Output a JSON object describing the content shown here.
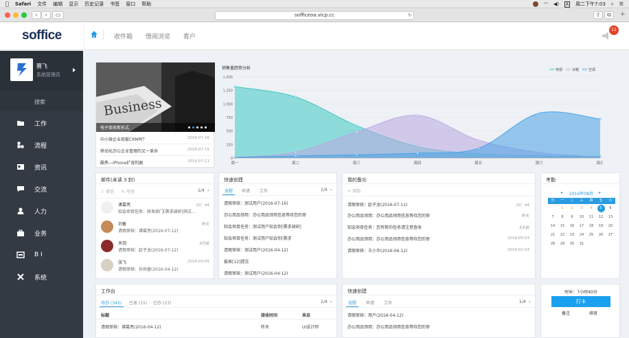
{
  "menubar": {
    "items": [
      "Safari",
      "文件",
      "编辑",
      "显示",
      "历史记录",
      "书签",
      "窗口",
      "帮助"
    ],
    "clock": "周二下午7:03",
    "input_method": "A"
  },
  "browser": {
    "url": "sofficeoa.vicp.cc"
  },
  "header": {
    "logo": "soffice",
    "nav": [
      "收件箱",
      "借阅浏览",
      "客户"
    ],
    "notification_count": "12"
  },
  "sidebar": {
    "user_name": "赛飞",
    "user_role": "系统管理员",
    "search_label": "搜索",
    "items": [
      {
        "label": "工作",
        "icon": "folder-icon"
      },
      {
        "label": "流程",
        "icon": "flow-icon"
      },
      {
        "label": "资讯",
        "icon": "news-icon"
      },
      {
        "label": "交流",
        "icon": "chat-icon"
      },
      {
        "label": "人力",
        "icon": "person-icon"
      },
      {
        "label": "业务",
        "icon": "briefcase-icon"
      },
      {
        "label": "B I",
        "icon": "bi-icon"
      },
      {
        "label": "系统",
        "icon": "tools-icon"
      }
    ]
  },
  "news": {
    "banner_word": "Business",
    "caption": "电子商务新形式",
    "items": [
      {
        "title": "中小微企业商套CRM吗？",
        "date": "2016-07-16"
      },
      {
        "title": "移动化办公企业管理的又一革命",
        "date": "2016-07-15"
      },
      {
        "title": "酷秀—iPhone扩容利器",
        "date": "2014-07-11"
      }
    ]
  },
  "colors": {
    "accent": "#2a9be0",
    "sidebar": "#333a43",
    "badge": "#e2452a",
    "teal": "#3fc9c4",
    "purple": "#b9a8e0",
    "blue": "#4aa3e6"
  },
  "chart_data": {
    "type": "area",
    "title": "销售量趋势分析",
    "categories": [
      "周一",
      "周二",
      "周三",
      "周四",
      "周五",
      "周六",
      "周日"
    ],
    "ylim": [
      0,
      1500
    ],
    "yticks": [
      "0",
      "250",
      "500",
      "750",
      "1,000",
      "1,250",
      "1,500"
    ],
    "grid": true,
    "legend_position": "top-right",
    "series": [
      {
        "name": "电视",
        "color": "#3fc9c4",
        "values": [
          1320,
          1130,
          600,
          210,
          80,
          40,
          30
        ]
      },
      {
        "name": "冰箱",
        "color": "#b9a8e0",
        "values": [
          10,
          110,
          480,
          790,
          330,
          100,
          20
        ]
      },
      {
        "name": "空调",
        "color": "#4aa3e6",
        "values": [
          10,
          40,
          60,
          90,
          180,
          830,
          720
        ]
      }
    ]
  },
  "mail": {
    "title": "邮件(未读 3 封)",
    "actions": [
      "收信",
      "写信"
    ],
    "page": "1/4",
    "items": [
      {
        "name": "诸葛亮",
        "text": "知会项目任务：研发部门[需求调研]测试...",
        "time": "20：44"
      },
      {
        "name": "刘备",
        "text": "请假审核：诸葛亮(2016-07-12)",
        "time": "昨天"
      },
      {
        "name": "关羽",
        "text": "请假审核：赵子龙(2016-07-12)",
        "time": "6月前"
      },
      {
        "name": "张飞",
        "text": "请假审核：孙尚香(2016-04-12)",
        "time": "2016-03-05"
      }
    ]
  },
  "quick1": {
    "title": "快速创建",
    "tabs": [
      "流程",
      "申请",
      "工作"
    ],
    "page": "1/4",
    "items": [
      "请假审核：测试用户(2016-07-16)",
      "办公用品领用：办公用品领用信息等待您的审",
      "知会项目任务：测试用户知会你[需求调研]",
      "知会项目任务：测试用户知会你[需求",
      "请假审核：测试用户(2016-04-12)",
      "报表[12]提交",
      "请假审核：测试用户(2016-04-12)"
    ]
  },
  "todo": {
    "title": "我的备忘",
    "add": "添加",
    "items": [
      {
        "text": "请假审核：赵子龙(2016-07-11)",
        "time": "20：44"
      },
      {
        "text": "办公用品领用：办公用品领用信息等待您的审",
        "time": "昨天"
      },
      {
        "text": "知会项目任务：您有新的任务请注意查收",
        "time": "6天前"
      },
      {
        "text": "办公用品领用：办公用品领用信息等待您的审",
        "time": "2016-05-03"
      },
      {
        "text": "请假审核：王小华(2016-06-12)",
        "time": "2016-01-03"
      }
    ]
  },
  "calendar": {
    "title": "考勤",
    "month": "2016年08月",
    "weekdays": [
      "日",
      "一",
      "二",
      "三",
      "四",
      "五",
      "六"
    ],
    "today": "5"
  },
  "workbench": {
    "title": "工作台",
    "tabs": [
      "待办 (343)",
      "已发 (15)",
      "已办 (23)"
    ],
    "page": "1/4",
    "columns": [
      "标题",
      "接收时间",
      "来自"
    ],
    "rows": [
      {
        "title": "请假审核：诸葛亮(2016-04-12)",
        "time": "昨天",
        "from": "UI设计师"
      }
    ]
  },
  "quick2": {
    "title": "快速创建",
    "tabs": [
      "流程",
      "申请",
      "工作"
    ],
    "page": "1/4",
    "items": [
      "请假审核：用户(2016-04-12)",
      "办公用品领用：办公用品领用信息等待您的审"
    ]
  },
  "clockin": {
    "duration": "时长：7小时40分",
    "button": "打卡",
    "links": [
      "备注",
      "排班"
    ]
  }
}
